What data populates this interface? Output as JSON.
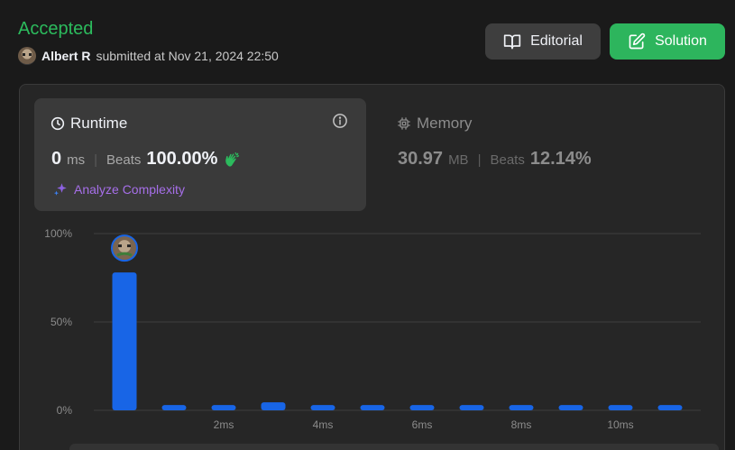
{
  "header": {
    "status": "Accepted",
    "submitter_name": "Albert R",
    "submitted_text": "submitted at Nov 21, 2024 22:50"
  },
  "buttons": {
    "editorial_label": "Editorial",
    "solution_label": "Solution"
  },
  "runtime": {
    "title": "Runtime",
    "value": "0",
    "unit": "ms",
    "beats_label": "Beats",
    "beats_value": "100.00%",
    "analyze_label": "Analyze Complexity"
  },
  "memory": {
    "title": "Memory",
    "value": "30.97",
    "unit": "MB",
    "beats_label": "Beats",
    "beats_value": "12.14%"
  },
  "colors": {
    "accepted": "#2cbb5d",
    "solution_button": "#2db55d",
    "bar": "#1865e6",
    "analyze": "#a66fe9",
    "clap": "#2cbb5d"
  },
  "icons": {
    "editorial": "book-open-icon",
    "solution": "edit-icon",
    "runtime": "clock-icon",
    "memory": "cpu-chip-icon",
    "info": "info-icon",
    "clap": "clapping-hands-icon",
    "analyze": "sparkle-icon"
  },
  "chart_data": {
    "type": "bar",
    "categories": [
      "0ms",
      "1ms",
      "2ms",
      "3ms",
      "4ms",
      "5ms",
      "6ms",
      "7ms",
      "8ms",
      "9ms",
      "10ms",
      "11ms"
    ],
    "values": [
      78,
      3,
      3,
      4.5,
      3,
      3,
      3,
      3,
      3,
      3,
      3,
      3
    ],
    "xtick_labels": [
      "2ms",
      "4ms",
      "6ms",
      "8ms",
      "10ms"
    ],
    "yticks": [
      "100%",
      "50%",
      "0%"
    ],
    "ylim": [
      0,
      100
    ],
    "grid": true,
    "highlight_bar_index": 0,
    "xlabel": "",
    "ylabel": ""
  }
}
